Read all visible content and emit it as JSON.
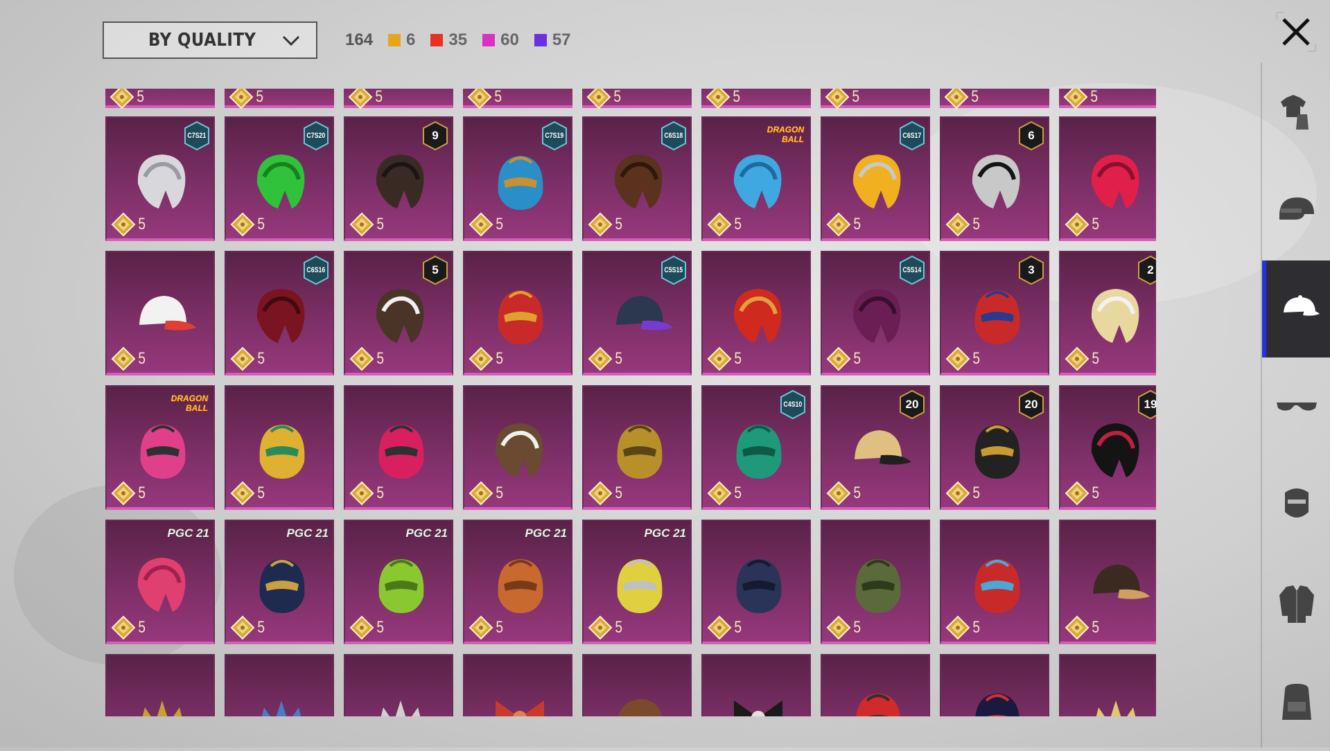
{
  "toolbar": {
    "sort_label": "BY QUALITY",
    "total": "164",
    "quality_counts": [
      {
        "color": "#e6a521",
        "count": "6"
      },
      {
        "color": "#e63125",
        "count": "35"
      },
      {
        "color": "#d632c6",
        "count": "60"
      },
      {
        "color": "#6b2fe0",
        "count": "57"
      }
    ]
  },
  "sidebar": {
    "tabs": [
      {
        "icon": "outfit-icon",
        "active": false
      },
      {
        "icon": "helmet-icon",
        "active": false
      },
      {
        "icon": "cap-icon",
        "active": true
      },
      {
        "icon": "glasses-icon",
        "active": false
      },
      {
        "icon": "mask-icon",
        "active": false
      },
      {
        "icon": "jacket-icon",
        "active": false
      },
      {
        "icon": "backpack-icon",
        "active": false
      }
    ]
  },
  "partial_top_row": [
    "5",
    "5",
    "5",
    "5",
    "5",
    "5",
    "5",
    "5",
    "5"
  ],
  "items": [
    {
      "cost": "5",
      "badge": "C7S21",
      "badge_type": "season",
      "art": "silver-hair",
      "colors": [
        "#d8d8dc",
        "#9a9aa2"
      ]
    },
    {
      "cost": "5",
      "badge": "C7S20",
      "badge_type": "season",
      "art": "green-hair",
      "colors": [
        "#2fc23a",
        "#17801f"
      ]
    },
    {
      "cost": "5",
      "badge": "9",
      "badge_type": "level",
      "art": "dark-long-hair",
      "colors": [
        "#3a2a24",
        "#1c1410"
      ]
    },
    {
      "cost": "5",
      "badge": "C7S19",
      "badge_type": "season",
      "art": "feather-helmet",
      "colors": [
        "#2a8fc8",
        "#c89030"
      ]
    },
    {
      "cost": "5",
      "badge": "C6S18",
      "badge_type": "season",
      "art": "brown-hair",
      "colors": [
        "#5a321e",
        "#2e180c"
      ]
    },
    {
      "cost": "5",
      "badge": "DRAGON BALL",
      "badge_type": "collab",
      "art": "blue-hair",
      "colors": [
        "#3fa8e0",
        "#1f6aa0"
      ]
    },
    {
      "cost": "5",
      "badge": "C6S17",
      "badge_type": "season",
      "art": "visor-hair",
      "colors": [
        "#f0b020",
        "#c8c8c8"
      ]
    },
    {
      "cost": "5",
      "badge": "6",
      "badge_type": "level",
      "art": "masked-hair",
      "colors": [
        "#c8c8c8",
        "#141414"
      ]
    },
    {
      "cost": "5",
      "badge": "",
      "badge_type": "none",
      "art": "red-pigtails",
      "colors": [
        "#e0204a",
        "#8a1030"
      ]
    },
    {
      "cost": "5",
      "badge": "",
      "badge_type": "none",
      "art": "lion-hat",
      "colors": [
        "#f2f2f2",
        "#e04030"
      ]
    },
    {
      "cost": "5",
      "badge": "C6S16",
      "badge_type": "season",
      "art": "crimson-hair",
      "colors": [
        "#7a1420",
        "#400a10"
      ]
    },
    {
      "cost": "5",
      "badge": "5",
      "badge_type": "level",
      "art": "bird-hair",
      "colors": [
        "#4a3428",
        "#f0f0f0"
      ]
    },
    {
      "cost": "5",
      "badge": "",
      "badge_type": "none",
      "art": "dragon-mask",
      "colors": [
        "#c82a2a",
        "#e0a030"
      ]
    },
    {
      "cost": "5",
      "badge": "C5S15",
      "badge_type": "season",
      "art": "baseball-cap",
      "colors": [
        "#2c3850",
        "#7a3ad0"
      ]
    },
    {
      "cost": "5",
      "badge": "",
      "badge_type": "none",
      "art": "crown-hair",
      "colors": [
        "#d02a1e",
        "#e0a040"
      ]
    },
    {
      "cost": "5",
      "badge": "C5S14",
      "badge_type": "season",
      "art": "purple-hair",
      "colors": [
        "#6a1e54",
        "#3a0e2e"
      ]
    },
    {
      "cost": "5",
      "badge": "3",
      "badge_type": "level",
      "art": "jester-helmet",
      "colors": [
        "#c82a2a",
        "#2a3a90"
      ]
    },
    {
      "cost": "5",
      "badge": "2",
      "badge_type": "level",
      "art": "sailor-hair",
      "colors": [
        "#e8d8a0",
        "#f2f2f2"
      ]
    },
    {
      "cost": "5",
      "badge": "DRAGON BALL",
      "badge_type": "collab",
      "art": "goggle-pink",
      "colors": [
        "#e0408a",
        "#303030"
      ]
    },
    {
      "cost": "5",
      "badge": "",
      "badge_type": "none",
      "art": "headdress",
      "colors": [
        "#e0b030",
        "#2a8a5a"
      ]
    },
    {
      "cost": "5",
      "badge": "",
      "badge_type": "none",
      "art": "mohawk-helmet",
      "colors": [
        "#d82060",
        "#303030"
      ]
    },
    {
      "cost": "5",
      "badge": "",
      "badge_type": "none",
      "art": "tied-hair",
      "colors": [
        "#6a4a30",
        "#f0f0f0"
      ]
    },
    {
      "cost": "5",
      "badge": "",
      "badge_type": "none",
      "art": "gold-horn-helmet",
      "colors": [
        "#b8902a",
        "#5a4418"
      ]
    },
    {
      "cost": "5",
      "badge": "C4S10",
      "badge_type": "season",
      "art": "green-helmet",
      "colors": [
        "#1e9a7a",
        "#0e5a46"
      ]
    },
    {
      "cost": "5",
      "badge": "20",
      "badge_type": "level",
      "art": "blonde-hat",
      "colors": [
        "#e0c080",
        "#202020"
      ]
    },
    {
      "cost": "5",
      "badge": "20",
      "badge_type": "level",
      "art": "gold-black-helmet",
      "colors": [
        "#222222",
        "#c89a30"
      ]
    },
    {
      "cost": "5",
      "badge": "19",
      "badge_type": "level",
      "art": "black-hair-ribbon",
      "colors": [
        "#141414",
        "#c02040"
      ]
    },
    {
      "cost": "5",
      "badge": "PGC 21",
      "badge_type": "pubg",
      "art": "pink-bob",
      "colors": [
        "#e04070",
        "#a02050"
      ]
    },
    {
      "cost": "5",
      "badge": "PGC 21",
      "badge_type": "pubg",
      "art": "navy-gold-helmet",
      "colors": [
        "#1e2a50",
        "#c8a040"
      ]
    },
    {
      "cost": "5",
      "badge": "PGC 21",
      "badge_type": "pubg",
      "art": "octopus-mask",
      "colors": [
        "#8ac830",
        "#4a7a18"
      ]
    },
    {
      "cost": "5",
      "badge": "PGC 21",
      "badge_type": "pubg",
      "art": "serpent-helmet",
      "colors": [
        "#c86a30",
        "#7a3a18"
      ]
    },
    {
      "cost": "5",
      "badge": "PGC 21",
      "badge_type": "pubg",
      "art": "knight-helmet",
      "colors": [
        "#e0d040",
        "#c0c0c0"
      ]
    },
    {
      "cost": "5",
      "badge": "",
      "badge_type": "none",
      "art": "navy-helmet",
      "colors": [
        "#2a3458",
        "#141a30"
      ]
    },
    {
      "cost": "5",
      "badge": "",
      "badge_type": "none",
      "art": "swamp-mask",
      "colors": [
        "#5a6a3a",
        "#2e3a1c"
      ]
    },
    {
      "cost": "5",
      "badge": "",
      "badge_type": "none",
      "art": "robot-helmet",
      "colors": [
        "#c82a2a",
        "#4aa8d8"
      ]
    },
    {
      "cost": "5",
      "badge": "",
      "badge_type": "none",
      "art": "scarecrow-hat",
      "colors": [
        "#3a2a20",
        "#d0a060"
      ]
    },
    {
      "cost": "",
      "badge": "",
      "badge_type": "none",
      "art": "gold-crest",
      "colors": [
        "#c8a030",
        "#2a7a6a"
      ]
    },
    {
      "cost": "",
      "badge": "",
      "badge_type": "none",
      "art": "blue-crown",
      "colors": [
        "#4a7ac8",
        "#e0c040"
      ]
    },
    {
      "cost": "",
      "badge": "",
      "badge_type": "none",
      "art": "silver-crown",
      "colors": [
        "#d0d0d0",
        "#8a2a2a"
      ]
    },
    {
      "cost": "",
      "badge": "",
      "badge_type": "none",
      "art": "red-bow",
      "colors": [
        "#c83a2a",
        "#e08050"
      ]
    },
    {
      "cost": "",
      "badge": "",
      "badge_type": "none",
      "art": "cowboy-hat",
      "colors": [
        "#7a4a2a",
        "#3a8a3a"
      ]
    },
    {
      "cost": "",
      "badge": "",
      "badge_type": "none",
      "art": "black-bow",
      "colors": [
        "#1a1a1a",
        "#e0e0e0"
      ]
    },
    {
      "cost": "",
      "badge": "",
      "badge_type": "none",
      "art": "red-feather",
      "colors": [
        "#d02a2a",
        "#303030"
      ]
    },
    {
      "cost": "",
      "badge": "",
      "badge_type": "none",
      "art": "dark-dome",
      "colors": [
        "#1a1a40",
        "#d03030"
      ]
    },
    {
      "cost": "",
      "badge": "",
      "badge_type": "none",
      "art": "halo-ring",
      "colors": [
        "#e0c870",
        "#e8e8e8"
      ]
    }
  ]
}
